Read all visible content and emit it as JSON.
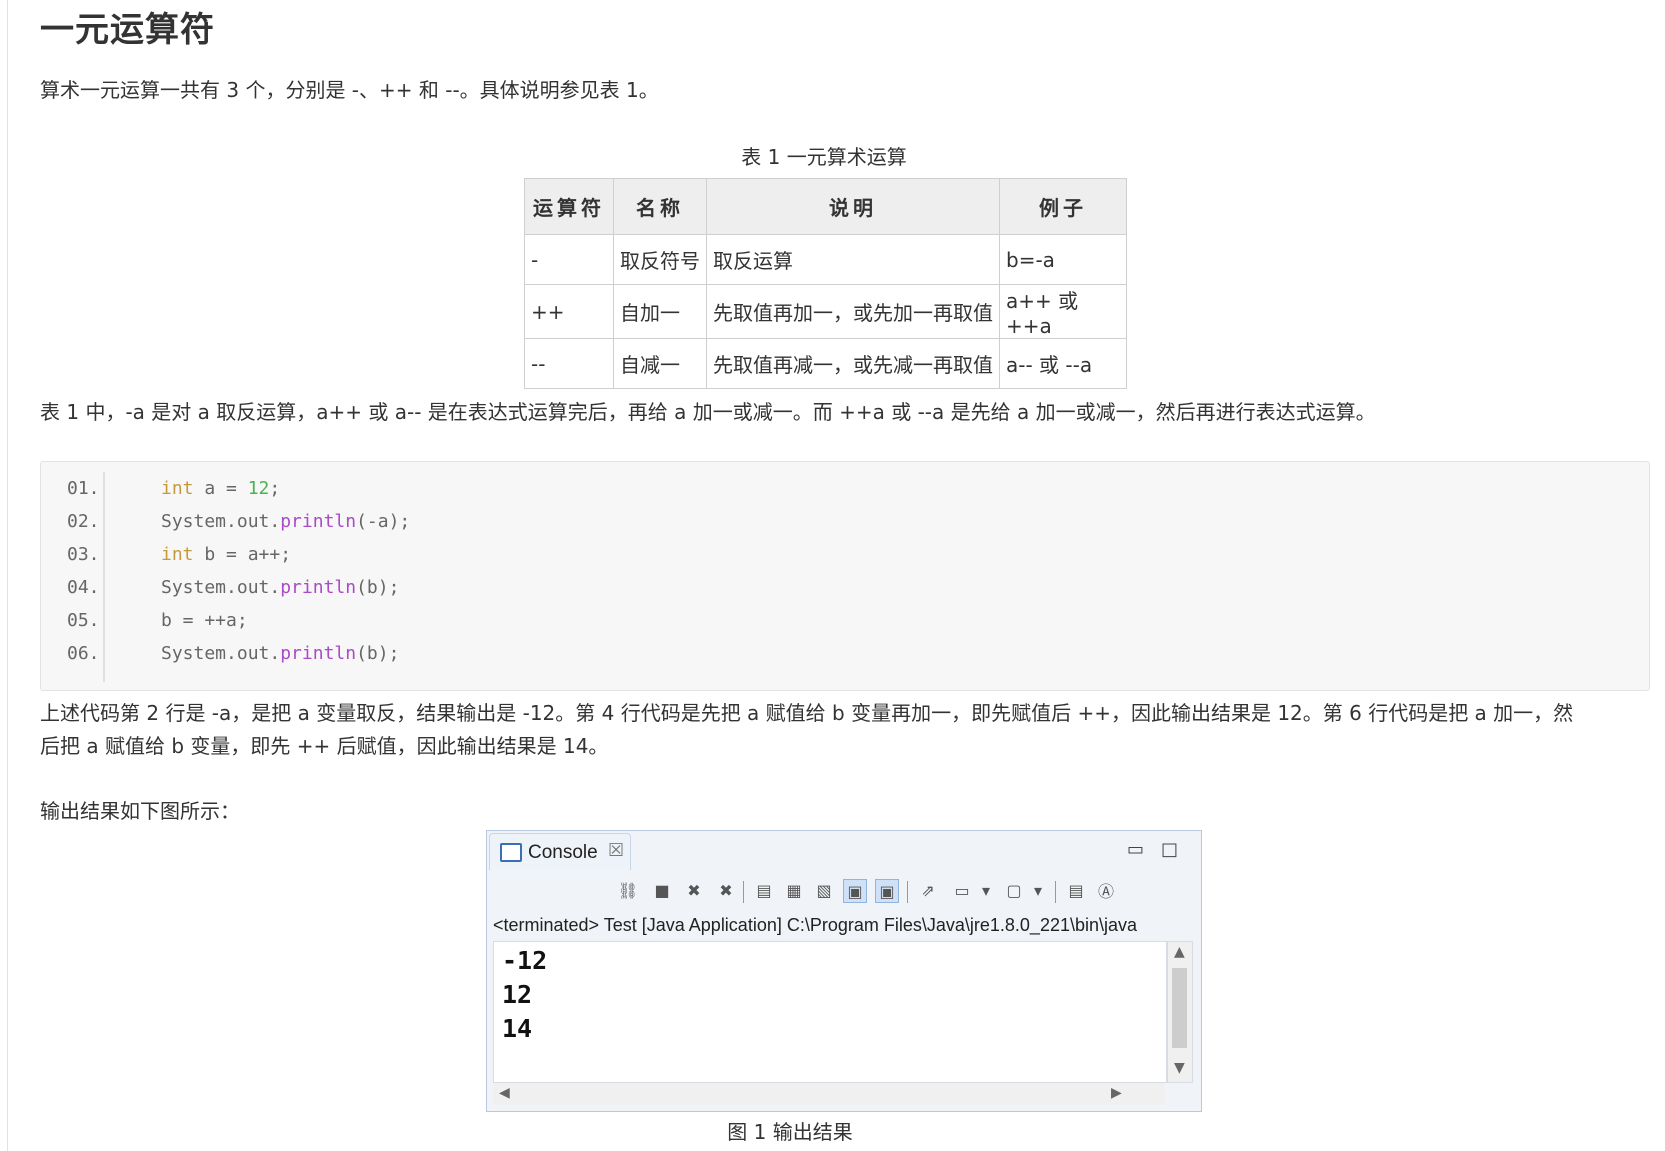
{
  "heading": "一元运算符",
  "intro": "算术一元运算一共有 3 个，分别是 -、++ 和 --。具体说明参见表 1。",
  "table": {
    "caption": "表 1 一元算术运算",
    "headers": [
      "运算符",
      "名称",
      "说明",
      "例子"
    ],
    "rows": [
      [
        "-",
        "取反符号",
        "取反运算",
        "b=-a"
      ],
      [
        "++",
        "自加一",
        "先取值再加一，或先加一再取值",
        "a++ 或 ++a"
      ],
      [
        "--",
        "自减一",
        "先取值再减一，或先减一再取值",
        "a-- 或 --a"
      ]
    ]
  },
  "explain": "表 1 中，-a 是对 a 取反运算，a++ 或 a-- 是在表达式运算完后，再给 a 加一或减一。而 ++a 或 --a 是先给 a 加一或减一，然后再进行表达式运算。",
  "code": {
    "line_numbers": [
      "01.",
      "02.",
      "03.",
      "04.",
      "05.",
      "06."
    ],
    "lines": [
      "int a = 12;",
      "System.out.println(-a);",
      "int b = a++;",
      "System.out.println(b);",
      "b = ++a;",
      "System.out.println(b);"
    ]
  },
  "result_para_1": "上述代码第 2 行是 -a，是把 a 变量取反，结果输出是 -12。第 4 行代码是先把 a 赋值给 b 变量再加一，即先赋值后 ++，因此输出结果是 12。第 6 行代码是把 a 加一，然",
  "result_para_2": "后把 a 赋值给 b 变量，即先 ++ 后赋值，因此输出结果是 14。",
  "output_intro": "输出结果如下图所示：",
  "console": {
    "tab_title": "Console",
    "close_glyph": "☒",
    "status": "<terminated> Test [Java Application] C:\\Program Files\\Java\\jre1.8.0_221\\bin\\java",
    "output": [
      "-12",
      "12",
      "14"
    ]
  },
  "figure_caption": "图 1  输出结果",
  "colors": {
    "keyword": "#c59a3a",
    "number": "#4eb04e",
    "method": "#a94ac7",
    "code_bg": "#f7f7f7"
  }
}
